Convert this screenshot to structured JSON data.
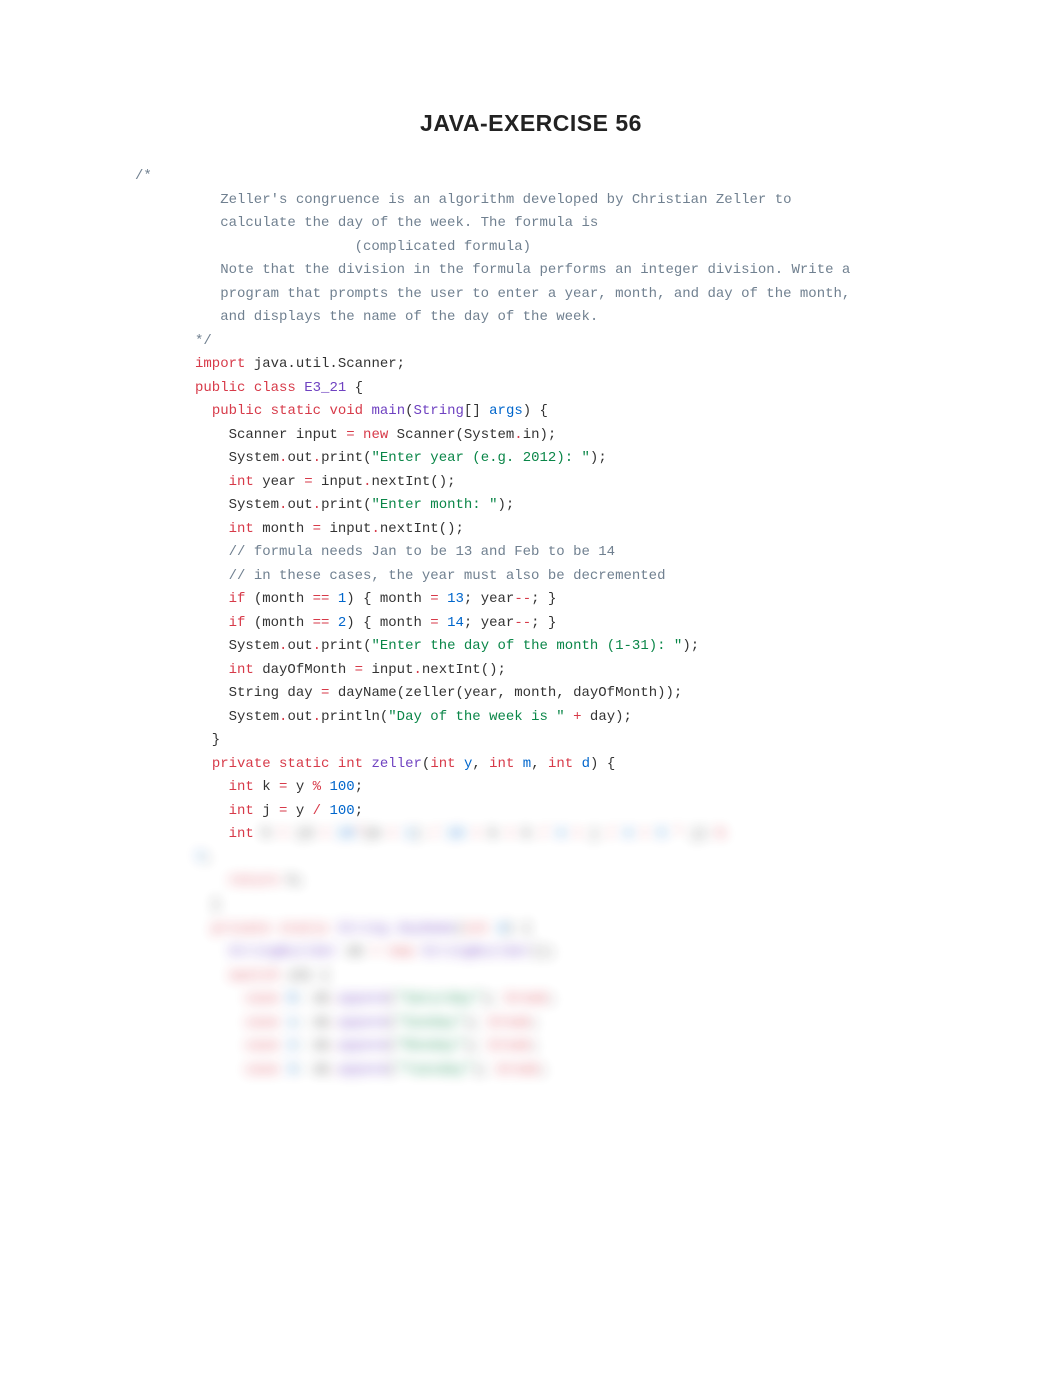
{
  "title": "JAVA-EXERCISE 56",
  "comment_lines": [
    "/*",
    "   Zeller's congruence is an algorithm developed by Christian Zeller to",
    "   calculate the day of the week. The formula is",
    "                   (complicated formula)",
    "   Note that the division in the formula performs an integer division. Write a",
    "   program that prompts the user to enter a year, month, and day of the month,",
    "   and displays the name of the day of the week.",
    "*/"
  ],
  "kw": {
    "import": "import",
    "public": "public",
    "class": "class",
    "static": "static",
    "void": "void",
    "new": "new",
    "int": "int",
    "if": "if",
    "private": "private",
    "return": "return",
    "switch": "switch",
    "case": "case",
    "break": "break"
  },
  "id": {
    "javaUtilScanner": " java.util.Scanner;",
    "E3_21": "E3_21",
    "main": "main",
    "String": "String",
    "args": "args",
    "Scanner": "Scanner",
    "input": "input",
    "SystemIn": "(System",
    "in": "in",
    "System": "System",
    "out": "out",
    "print": "print",
    "println": "println",
    "year": "year",
    "nextInt": "nextInt",
    "month": "month",
    "dayOfMonth": "dayOfMonth",
    "day": "day",
    "dayName": "dayName",
    "zeller": "zeller",
    "y": "y",
    "m": "m",
    "d": "d",
    "k": "k",
    "j": "j",
    "h": "h",
    "StringBuilder": "StringBuilder",
    "sb": "sb",
    "append": "append"
  },
  "str": {
    "enterYear": "\"Enter year (e.g. 2012): \"",
    "enterMonth": "\"Enter month: \"",
    "enterDay": "\"Enter the day of the month (1-31): \"",
    "dayOfWeek": "\"Day of the week is \"",
    "Saturday": "\"Saturday\"",
    "Sunday": "\"Sunday\"",
    "Monday": "\"Monday\"",
    "Tuesday": "\"Tuesday\""
  },
  "num": {
    "n1": "1",
    "n2": "2",
    "n13": "13",
    "n14": "14",
    "n100": "100",
    "n0": "0",
    "n3": "3",
    "n4": "4",
    "n5": "5",
    "n7": "7",
    "n26": "26",
    "n10": "10"
  },
  "cmt": {
    "c1": "// formula needs Jan to be 13 and Feb to be 14",
    "c2": "// in these cases, the year must also be decremented"
  },
  "blurred_visible": true
}
